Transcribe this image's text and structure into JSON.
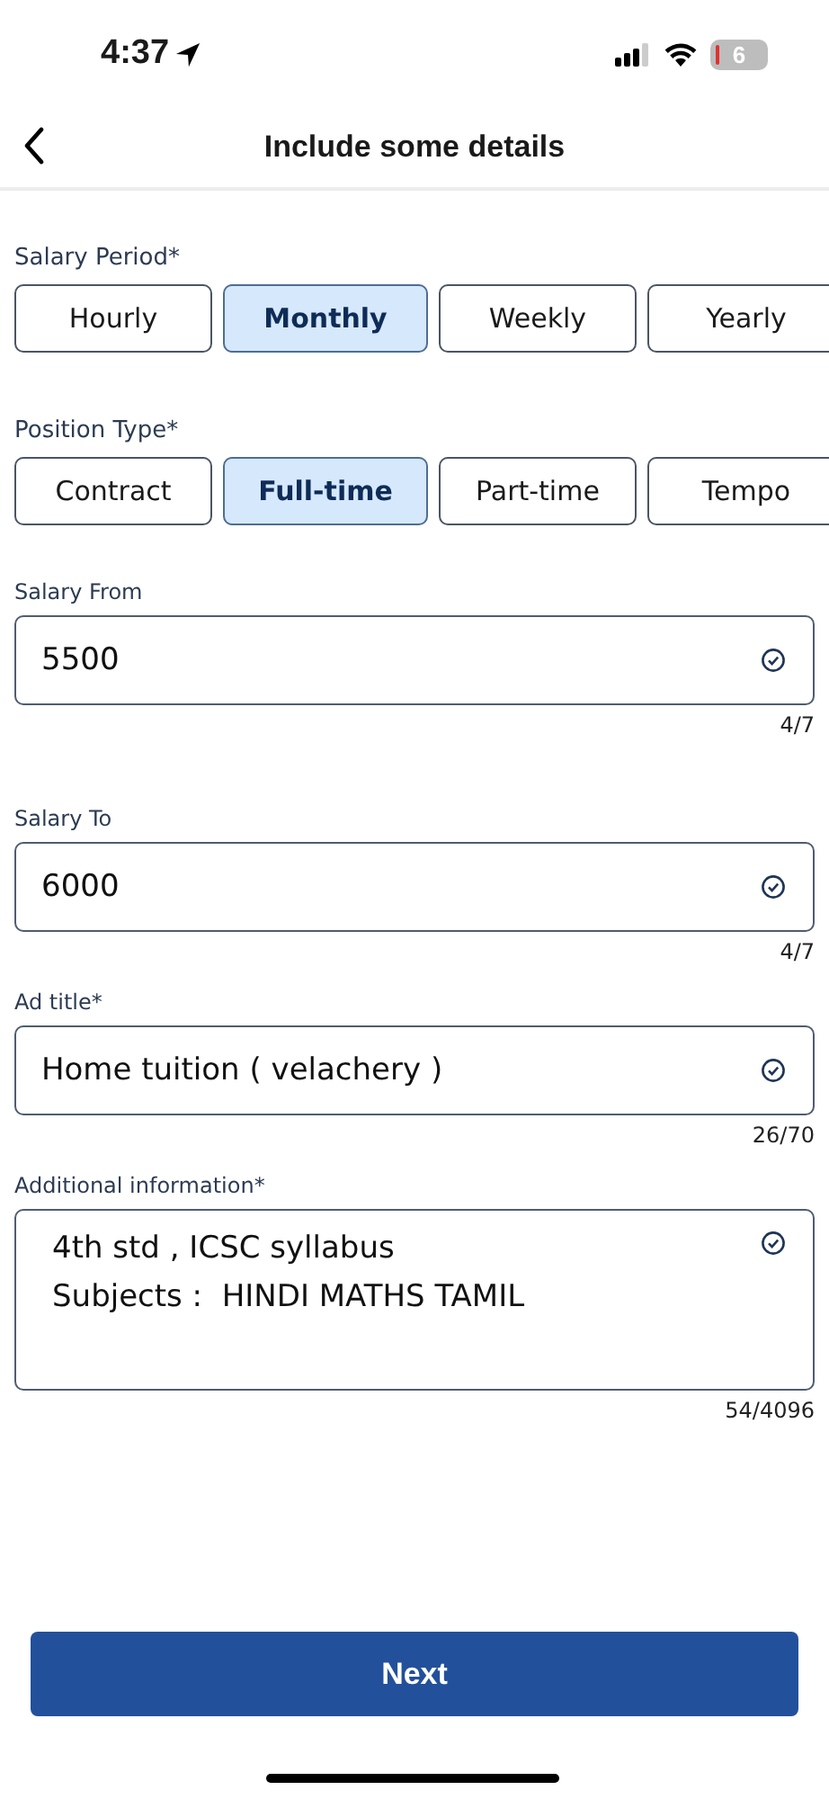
{
  "status_bar": {
    "time": "4:37",
    "battery": "6"
  },
  "header": {
    "title": "Include some details"
  },
  "option_groups": [
    {
      "label": "Salary Period*",
      "options": [
        {
          "label": "Hourly",
          "selected": false
        },
        {
          "label": "Monthly",
          "selected": true
        },
        {
          "label": "Weekly",
          "selected": false
        },
        {
          "label": "Yearly",
          "selected": false
        }
      ]
    },
    {
      "label": "Position Type*",
      "options": [
        {
          "label": "Contract",
          "selected": false
        },
        {
          "label": "Full-time",
          "selected": true
        },
        {
          "label": "Part-time",
          "selected": false
        },
        {
          "label": "Tempo",
          "selected": false
        }
      ]
    }
  ],
  "fields": [
    {
      "kind": "input",
      "label": "Salary From",
      "value": "5500",
      "valid": true,
      "counter": "4/7"
    },
    {
      "kind": "input",
      "label": "Salary To",
      "value": "6000",
      "valid": true,
      "counter": "4/7"
    },
    {
      "kind": "input",
      "label": "Ad title*",
      "value": "Home tuition ( velachery )",
      "valid": true,
      "counter": "26/70"
    },
    {
      "kind": "textarea",
      "label": "Additional information*",
      "value": "4th std , ICSC syllabus\nSubjects :  HINDI MATHS TAMIL",
      "valid": true,
      "counter": "54/4096"
    }
  ],
  "next_button": {
    "label": "Next"
  }
}
